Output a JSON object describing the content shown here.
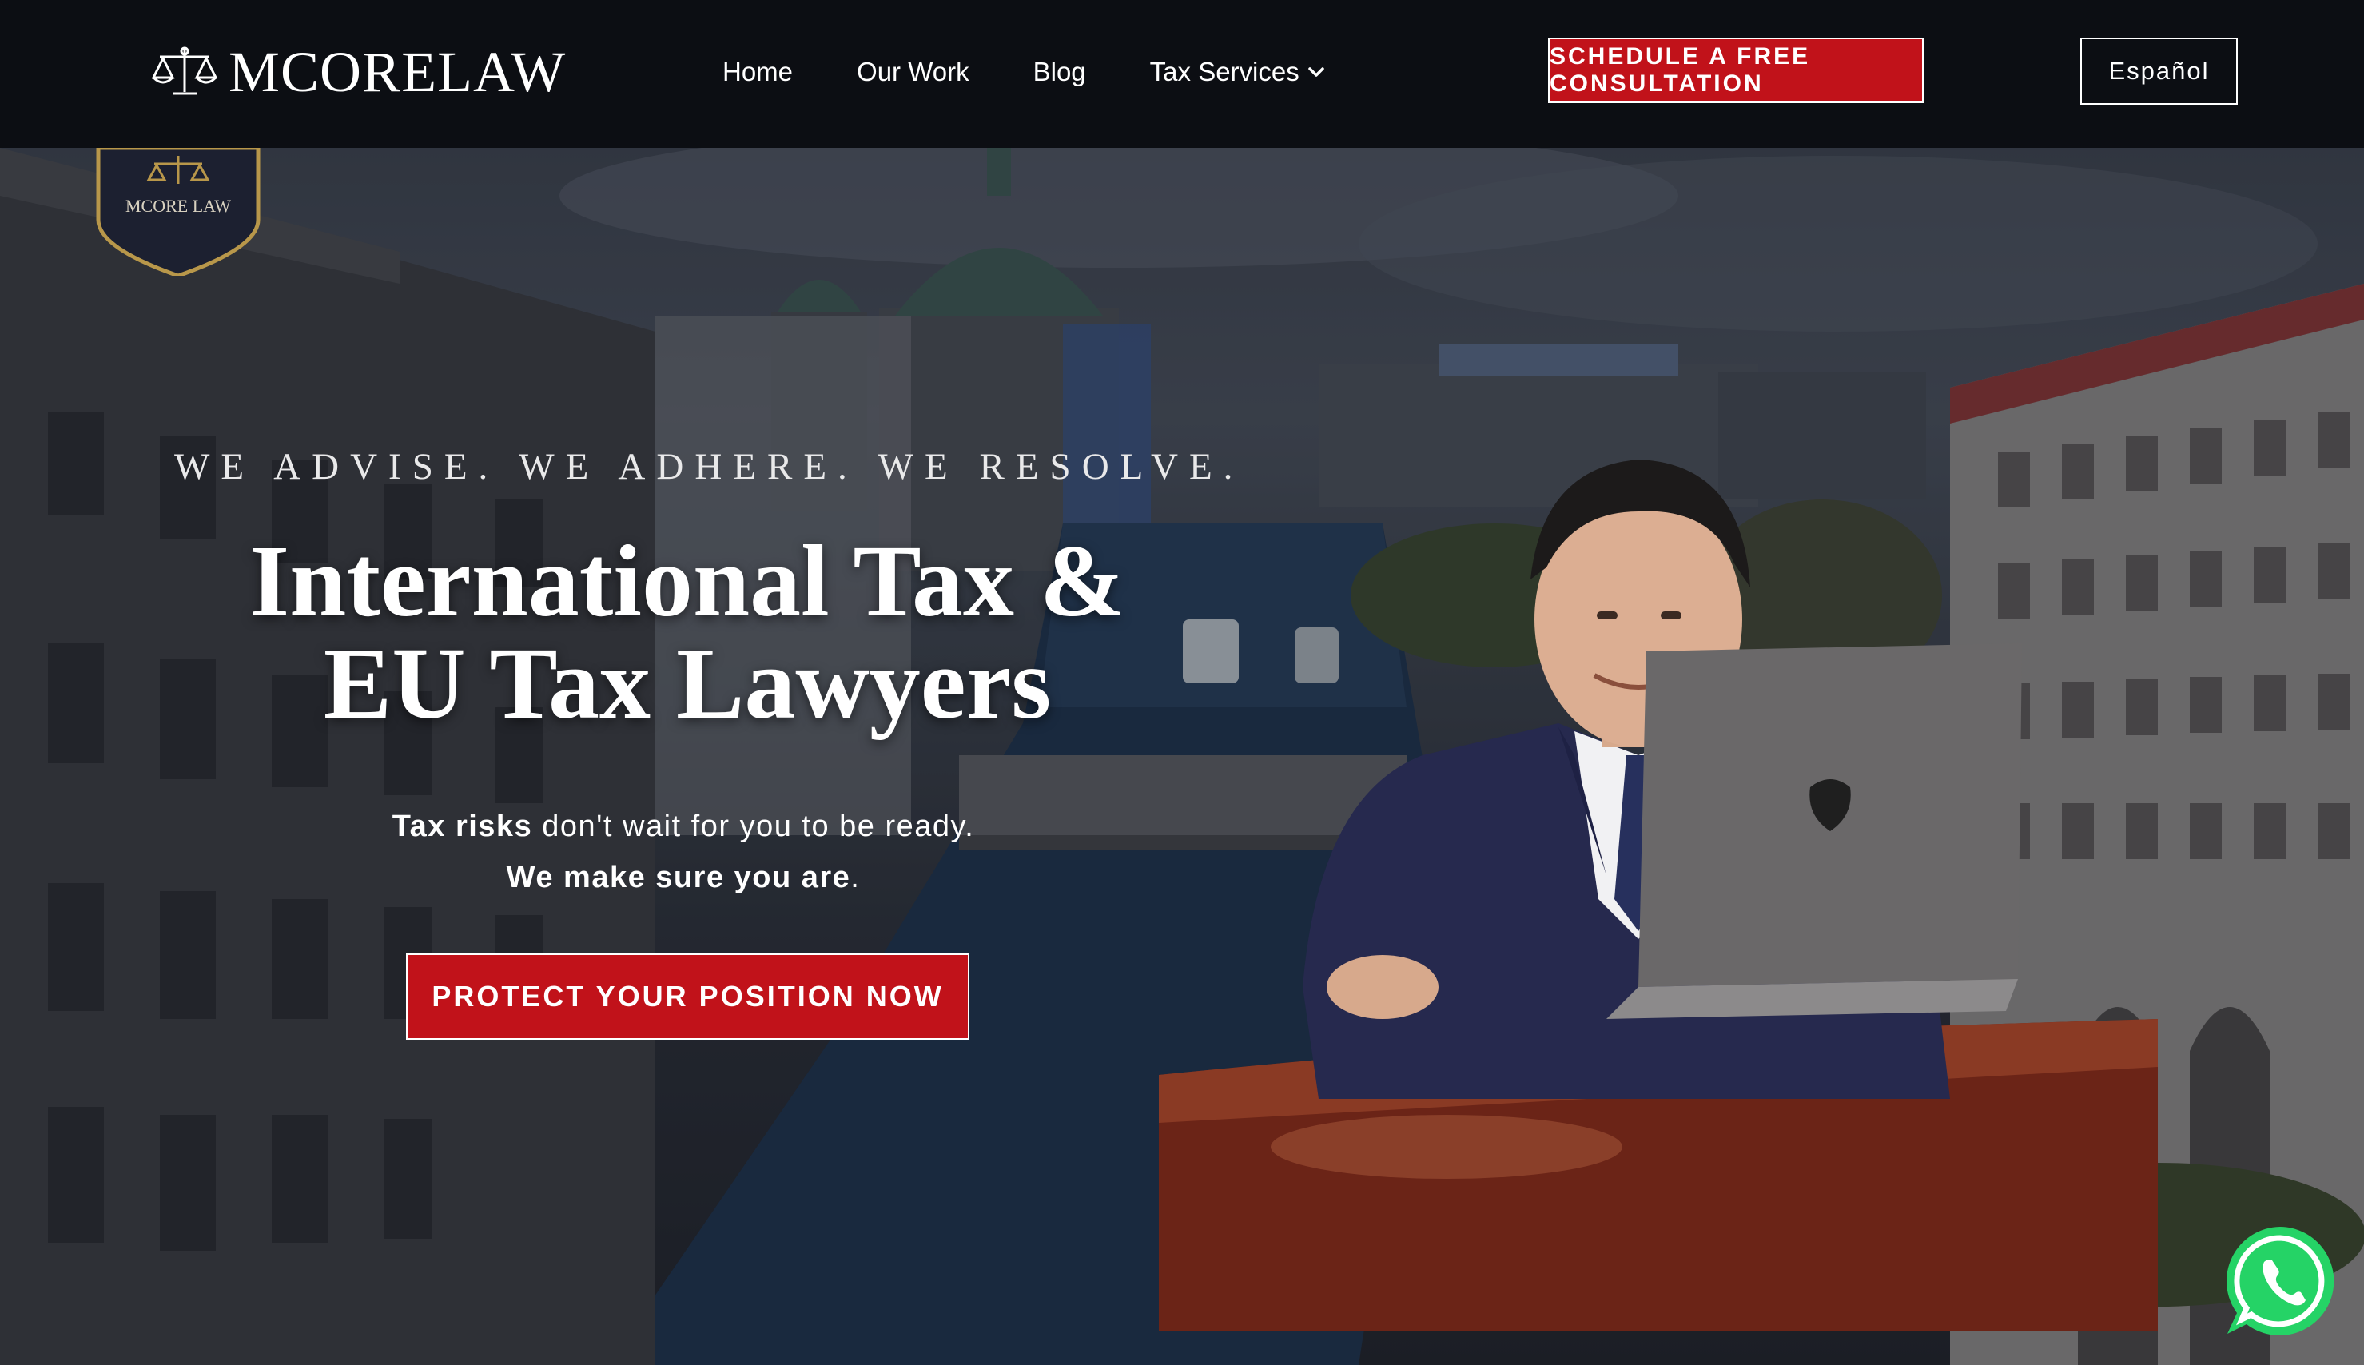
{
  "brand": {
    "name": "MCORELAW",
    "seal_text": "MCORE LAW"
  },
  "nav": {
    "items": [
      {
        "label": "Home"
      },
      {
        "label": "Our Work"
      },
      {
        "label": "Blog"
      },
      {
        "label": "Tax Services",
        "icon": "chevron-down-icon"
      }
    ],
    "cta_label": "SCHEDULE A FREE CONSULTATION",
    "language_label": "Español"
  },
  "hero": {
    "tagline": "WE ADVISE. WE ADHERE. WE RESOLVE.",
    "headline_line1": "International Tax &",
    "headline_line2": "EU Tax Lawyers",
    "sub_bold_1": "Tax risks",
    "sub_text_1": " don't wait for you to be ready.",
    "sub_bold_2": "We make sure you are",
    "sub_text_2": ".",
    "button_label": "PROTECT YOUR POSITION NOW"
  },
  "colors": {
    "accent": "#c1121a",
    "nav_bg": "#0c0e13",
    "whatsapp": "#25d366"
  },
  "floating": {
    "icon": "whatsapp-icon"
  }
}
